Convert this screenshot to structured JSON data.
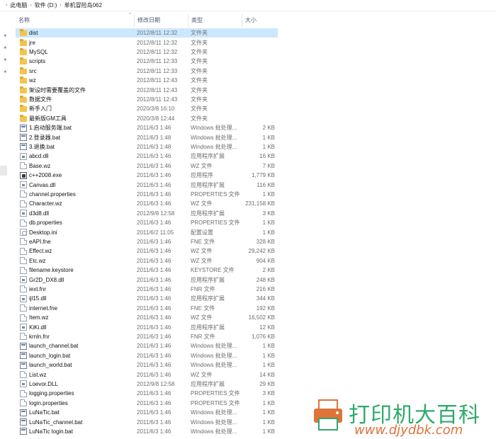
{
  "breadcrumb": [
    "此电脑",
    "软件 (D:)",
    "单机冒险岛062"
  ],
  "columns": {
    "name": "名称",
    "date": "修改日期",
    "type": "类型",
    "size": "大小"
  },
  "files": [
    {
      "name": "dist",
      "date": "2012/8/11 12:32",
      "type": "文件夹",
      "size": "",
      "icon": "folder"
    },
    {
      "name": "jre",
      "date": "2012/8/11 12:32",
      "type": "文件夹",
      "size": "",
      "icon": "folder"
    },
    {
      "name": "MySQL",
      "date": "2012/8/11 12:32",
      "type": "文件夹",
      "size": "",
      "icon": "folder"
    },
    {
      "name": "scripts",
      "date": "2012/8/11 12:33",
      "type": "文件夹",
      "size": "",
      "icon": "folder"
    },
    {
      "name": "src",
      "date": "2012/8/11 12:33",
      "type": "文件夹",
      "size": "",
      "icon": "folder"
    },
    {
      "name": "wz",
      "date": "2012/8/11 12:43",
      "type": "文件夹",
      "size": "",
      "icon": "folder"
    },
    {
      "name": "架设时需要覆盖的文件",
      "date": "2012/8/11 12:43",
      "type": "文件夹",
      "size": "",
      "icon": "folder"
    },
    {
      "name": "数据文件",
      "date": "2012/8/11 12:43",
      "type": "文件夹",
      "size": "",
      "icon": "folder"
    },
    {
      "name": "新手入门",
      "date": "2020/3/8 16:10",
      "type": "文件夹",
      "size": "",
      "icon": "folder"
    },
    {
      "name": "最新版GM工具",
      "date": "2020/3/8 12:44",
      "type": "文件夹",
      "size": "",
      "icon": "folder"
    },
    {
      "name": "1.启动服务端.bat",
      "date": "2011/6/3 1:46",
      "type": "Windows 批处理...",
      "size": "2 KB",
      "icon": "bat"
    },
    {
      "name": "2.登录器.bat",
      "date": "2011/6/3 1:48",
      "type": "Windows 批处理...",
      "size": "1 KB",
      "icon": "bat"
    },
    {
      "name": "3.退换.bat",
      "date": "2011/6/3 1:48",
      "type": "Windows 批处理...",
      "size": "1 KB",
      "icon": "bat"
    },
    {
      "name": "abcd.dll",
      "date": "2011/6/3 1:46",
      "type": "应用程序扩展",
      "size": "16 KB",
      "icon": "dll"
    },
    {
      "name": "Base.wz",
      "date": "2011/6/3 1:46",
      "type": "WZ 文件",
      "size": "7 KB",
      "icon": "doc"
    },
    {
      "name": "c++2008.exe",
      "date": "2011/6/3 1:46",
      "type": "应用程序",
      "size": "1,779 KB",
      "icon": "exe"
    },
    {
      "name": "Canvas.dll",
      "date": "2011/6/3 1:46",
      "type": "应用程序扩展",
      "size": "116 KB",
      "icon": "dll"
    },
    {
      "name": "channel.properties",
      "date": "2011/6/3 1:46",
      "type": "PROPERTIES 文件",
      "size": "1 KB",
      "icon": "doc"
    },
    {
      "name": "Character.wz",
      "date": "2011/6/3 1:46",
      "type": "WZ 文件",
      "size": "231,158 KB",
      "icon": "doc"
    },
    {
      "name": "d3d8.dll",
      "date": "2012/9/8 12:58",
      "type": "应用程序扩展",
      "size": "3 KB",
      "icon": "dll"
    },
    {
      "name": "db.properties",
      "date": "2011/6/3 1:46",
      "type": "PROPERTIES 文件",
      "size": "1 KB",
      "icon": "doc"
    },
    {
      "name": "Desktop.ini",
      "date": "2011/6/2 11:05",
      "type": "配置设置",
      "size": "1 KB",
      "icon": "ini"
    },
    {
      "name": "eAPI.fne",
      "date": "2011/6/3 1:46",
      "type": "FNE 文件",
      "size": "328 KB",
      "icon": "doc"
    },
    {
      "name": "Effect.wz",
      "date": "2011/6/3 1:46",
      "type": "WZ 文件",
      "size": "29,242 KB",
      "icon": "doc"
    },
    {
      "name": "Etc.wz",
      "date": "2011/6/3 1:46",
      "type": "WZ 文件",
      "size": "904 KB",
      "icon": "doc"
    },
    {
      "name": "filename.keystore",
      "date": "2011/6/3 1:46",
      "type": "KEYSTORE 文件",
      "size": "2 KB",
      "icon": "doc"
    },
    {
      "name": "Gr2D_DX8.dll",
      "date": "2011/6/3 1:46",
      "type": "应用程序扩展",
      "size": "248 KB",
      "icon": "dll"
    },
    {
      "name": "iext.fnr",
      "date": "2011/6/3 1:46",
      "type": "FNR 文件",
      "size": "216 KB",
      "icon": "doc"
    },
    {
      "name": "ijl15.dll",
      "date": "2011/6/3 1:46",
      "type": "应用程序扩展",
      "size": "344 KB",
      "icon": "dll"
    },
    {
      "name": "internet.fne",
      "date": "2011/6/3 1:46",
      "type": "FNE 文件",
      "size": "192 KB",
      "icon": "doc"
    },
    {
      "name": "Item.wz",
      "date": "2011/6/3 1:46",
      "type": "WZ 文件",
      "size": "16,502 KB",
      "icon": "doc"
    },
    {
      "name": "KiKi.dll",
      "date": "2011/6/3 1:46",
      "type": "应用程序扩展",
      "size": "12 KB",
      "icon": "dll"
    },
    {
      "name": "krnln.fnr",
      "date": "2011/6/3 1:46",
      "type": "FNR 文件",
      "size": "1,076 KB",
      "icon": "doc"
    },
    {
      "name": "launch_channel.bat",
      "date": "2011/6/3 1:46",
      "type": "Windows 批处理...",
      "size": "1 KB",
      "icon": "bat"
    },
    {
      "name": "launch_login.bat",
      "date": "2011/6/3 1:46",
      "type": "Windows 批处理...",
      "size": "1 KB",
      "icon": "bat"
    },
    {
      "name": "launch_world.bat",
      "date": "2011/6/3 1:46",
      "type": "Windows 批处理...",
      "size": "1 KB",
      "icon": "bat"
    },
    {
      "name": "List.wz",
      "date": "2011/6/3 1:46",
      "type": "WZ 文件",
      "size": "14 KB",
      "icon": "doc"
    },
    {
      "name": "Loevor.DLL",
      "date": "2012/9/8 12:58",
      "type": "应用程序扩展",
      "size": "29 KB",
      "icon": "dll"
    },
    {
      "name": "logging.properties",
      "date": "2011/6/3 1:46",
      "type": "PROPERTIES 文件",
      "size": "3 KB",
      "icon": "doc"
    },
    {
      "name": "login.properties",
      "date": "2011/6/3 1:46",
      "type": "PROPERTIES 文件",
      "size": "1 KB",
      "icon": "doc"
    },
    {
      "name": "LuNaTic.bat",
      "date": "2011/6/3 1:46",
      "type": "Windows 批处理...",
      "size": "1 KB",
      "icon": "bat"
    },
    {
      "name": "LuNaTic_channel.bat",
      "date": "2011/6/3 1:46",
      "type": "Windows 批处理...",
      "size": "1 KB",
      "icon": "bat"
    },
    {
      "name": "LuNaTic login.bat",
      "date": "2011/6/3 1:46",
      "type": "Windows 批处理...",
      "size": "1 KB",
      "icon": "bat"
    }
  ],
  "watermark": {
    "text": "打印机大百科",
    "url": "www.djydbk.com"
  }
}
